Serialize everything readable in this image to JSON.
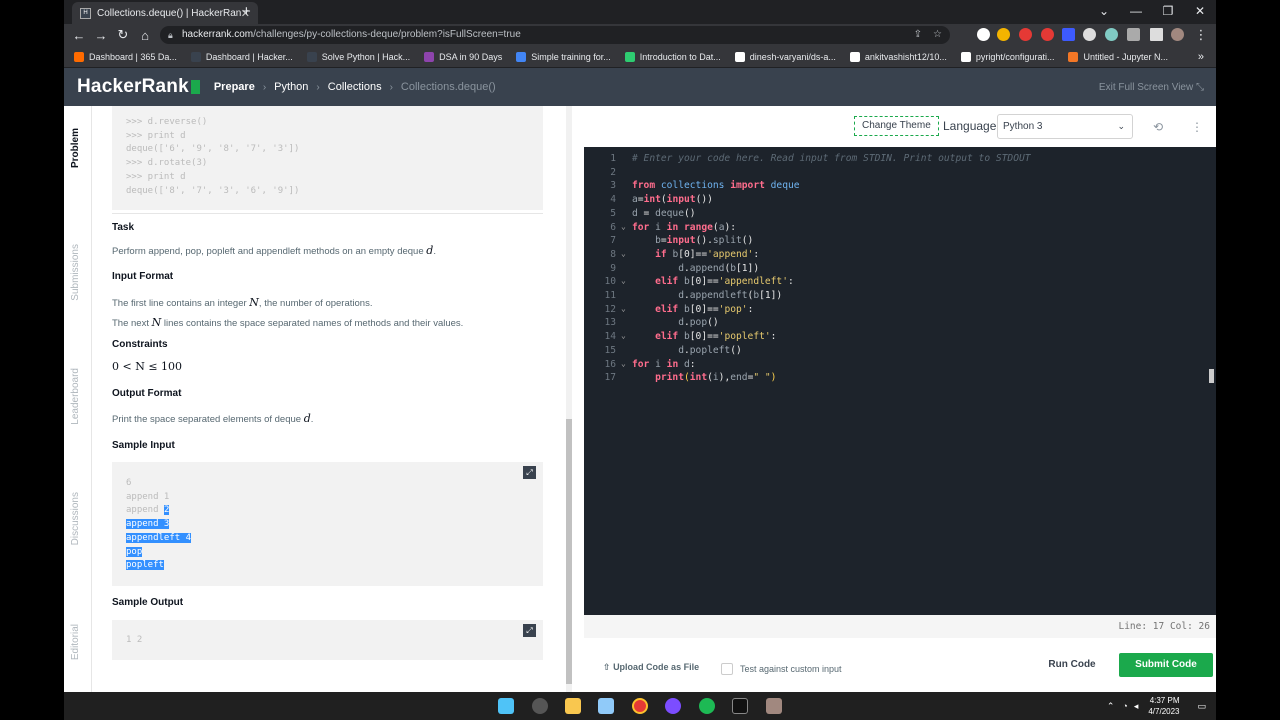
{
  "browser": {
    "tab_title": "Collections.deque() | HackerRank",
    "tab_close": "✕",
    "new_tab": "+",
    "url_host": "hackerrank.com",
    "url_path": "/challenges/py-collections-deque/problem?isFullScreen=true",
    "window_controls": [
      "⌄",
      "—",
      "❐",
      "✕"
    ],
    "bookmarks": [
      {
        "label": "Dashboard | 365 Da...",
        "color": "#ff6b00"
      },
      {
        "label": "Dashboard | Hacker...",
        "color": "#39424e"
      },
      {
        "label": "Solve Python | Hack...",
        "color": "#39424e"
      },
      {
        "label": "DSA in 90 Days",
        "color": "#8e44ad"
      },
      {
        "label": "Simple training for...",
        "color": "#4285f4"
      },
      {
        "label": "Introduction to Dat...",
        "color": "#2ecc71"
      },
      {
        "label": "dinesh-varyani/ds-a...",
        "color": "#ffffff"
      },
      {
        "label": "ankitvashisht12/10...",
        "color": "#ffffff"
      },
      {
        "label": "pyright/configurati...",
        "color": "#ffffff"
      },
      {
        "label": "Untitled - Jupyter N...",
        "color": "#f37726"
      }
    ],
    "bookmarks_more": "»"
  },
  "header": {
    "logo": "HackerRank",
    "crumbs": [
      "Prepare",
      "Python",
      "Collections",
      "Collections.deque()"
    ],
    "exit_full": "Exit Full Screen View"
  },
  "side_tabs": [
    "Problem",
    "Submissions",
    "Leaderboard",
    "Discussions",
    "Editorial"
  ],
  "problem": {
    "top_code": [
      ">>> d.reverse()",
      ">>> print d",
      "deque(['6', '9', '8', '7', '3'])",
      ">>> d.rotate(3)",
      ">>> print d",
      "deque(['8', '7', '3', '6', '9'])"
    ],
    "task_title": "Task",
    "task_text": "Perform append, pop, popleft and appendleft methods on an empty deque",
    "task_var": "d",
    "input_title": "Input Format",
    "input_line1a": "The first line contains an integer",
    "input_line1b": ", the number of operations.",
    "input_line2a": "The next",
    "input_line2b": "lines contains the space separated names of methods and their values.",
    "n_var": "N",
    "constraints_title": "Constraints",
    "constraint": "0 < N ≤ 100",
    "output_title": "Output Format",
    "output_text": "Print the space separated elements of deque",
    "output_var": "d",
    "sample_input_title": "Sample Input",
    "sample_input_plain": [
      "6",
      "append 1",
      "append "
    ],
    "sample_input_sel_start": "2",
    "sample_input_selected": [
      "append 3",
      "appendleft 4",
      "pop",
      "popleft"
    ],
    "sample_output_title": "Sample Output",
    "sample_output": "1 2"
  },
  "editor": {
    "change_theme": "Change Theme",
    "language_label": "Language",
    "language": "Python 3",
    "status": "Line: 17 Col: 26",
    "upload": "Upload Code as File",
    "custom_input": "Test against custom input",
    "run": "Run Code",
    "submit": "Submit Code"
  },
  "taskbar": {
    "time": "4:37 PM",
    "date": "4/7/2023"
  }
}
